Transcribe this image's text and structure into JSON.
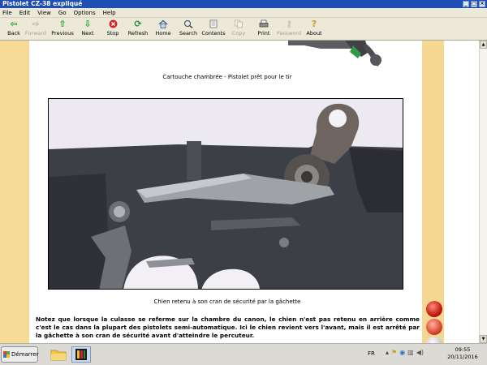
{
  "window": {
    "title": "Pistolet CZ-38 expliqué"
  },
  "menu": [
    "File",
    "Edit",
    "View",
    "Go",
    "Options",
    "Help"
  ],
  "toolbar": {
    "buttons": [
      {
        "label": "Back",
        "icon": "back-arrow-icon"
      },
      {
        "label": "Forward",
        "icon": "forward-arrow-icon"
      },
      {
        "label": "Previous",
        "icon": "previous-arrow-icon"
      },
      {
        "label": "Next",
        "icon": "next-arrow-icon"
      },
      {
        "label": "Stop",
        "icon": "stop-icon"
      },
      {
        "label": "Refresh",
        "icon": "refresh-icon"
      },
      {
        "label": "Home",
        "icon": "home-icon"
      },
      {
        "label": "Search",
        "icon": "search-icon"
      },
      {
        "label": "Contents",
        "icon": "contents-icon"
      },
      {
        "label": "Copy",
        "icon": "copy-icon"
      },
      {
        "label": "Print",
        "icon": "print-icon"
      },
      {
        "label": "Password",
        "icon": "password-icon"
      },
      {
        "label": "About",
        "icon": "about-icon"
      }
    ]
  },
  "page": {
    "caption_top": "Cartouche chambrée - Pistolet prêt pour le tir",
    "caption_photo": "Chien retenu à son cran de sécurité par la gâchette",
    "paragraph": "Notez que lorsque la culasse se referme sur la chambre du canon, le chien n'est pas retenu en arrière comme c'est le cas dans la plupart des pistolets semi-automatique. Ici le chien revient vers l'avant, mais il est arrêté par la gâchette à son cran de sécurité avant d'atteindre le percuteur."
  },
  "taskbar": {
    "start_label": "Démarrer",
    "language": "FR",
    "time": "09:55",
    "date": "20/11/2016"
  },
  "colors": {
    "titlebar": "#1f4fb4",
    "chrome": "#ece9d8",
    "side_strip": "#f7d998",
    "stop_red": "#d42020",
    "nav_green": "#1aa12e"
  }
}
